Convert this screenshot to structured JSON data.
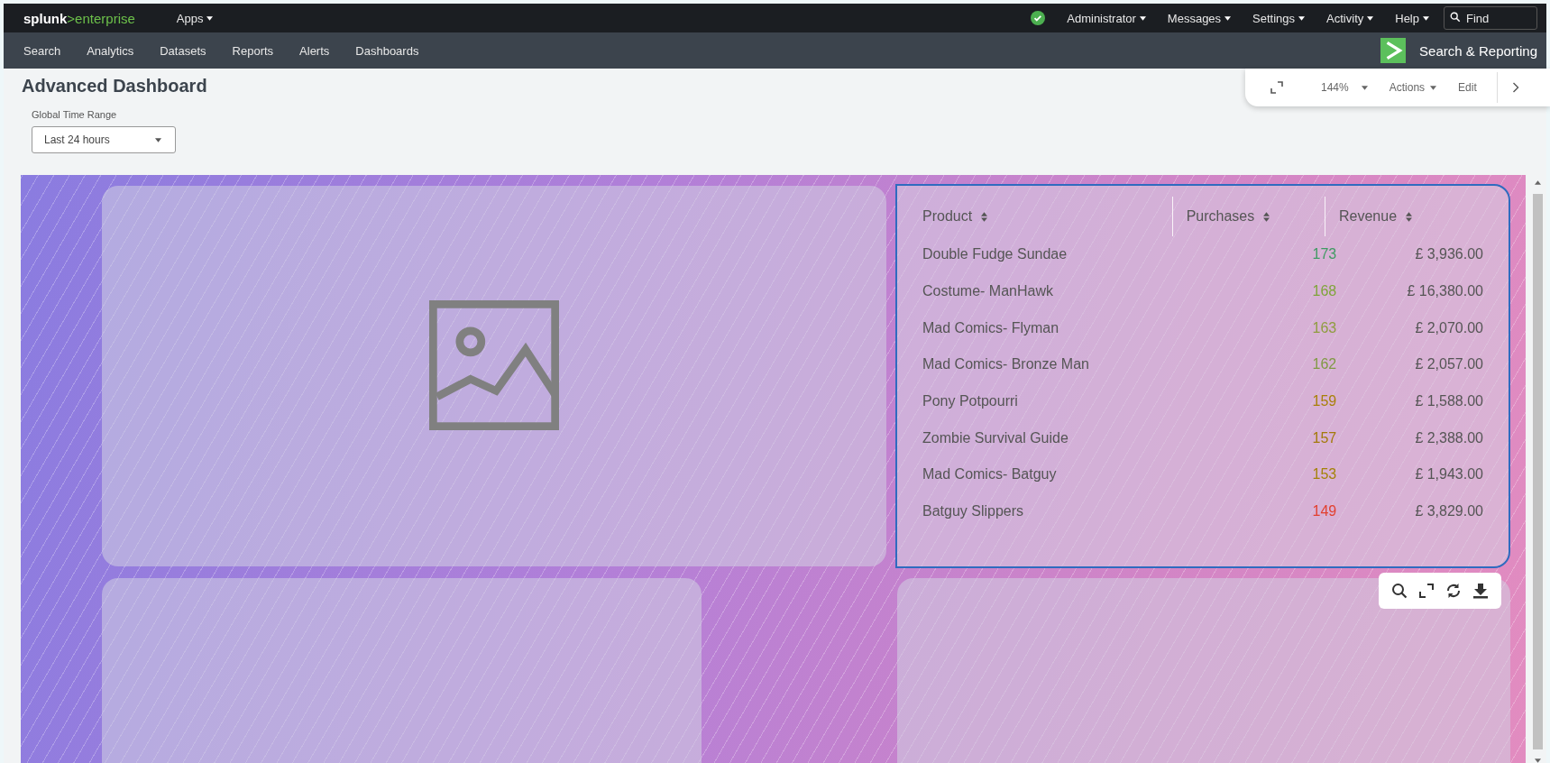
{
  "topbar": {
    "logo": {
      "brand": "splunk",
      "product": ">enterprise"
    },
    "apps_menu": "Apps",
    "menus": [
      "Administrator",
      "Messages",
      "Settings",
      "Activity",
      "Help"
    ],
    "search": {
      "placeholder": "Find"
    }
  },
  "nav": {
    "items": [
      "Search",
      "Analytics",
      "Datasets",
      "Reports",
      "Alerts",
      "Dashboards"
    ],
    "app_name": "Search & Reporting"
  },
  "dashboard": {
    "title": "Advanced Dashboard",
    "toolbar": {
      "zoom": "144%",
      "actions": "Actions",
      "edit": "Edit"
    }
  },
  "time_input": {
    "label": "Global Time Range",
    "value": "Last 24 hours"
  },
  "table": {
    "columns": [
      "Product",
      "Purchases",
      "Revenue"
    ],
    "rows": [
      {
        "product": "Double Fudge Sundae",
        "purchases": "173",
        "color": "#3f9a62",
        "revenue": "£ 3,936.00"
      },
      {
        "product": "Costume- ManHawk",
        "purchases": "168",
        "color": "#7fa43a",
        "revenue": "£ 16,380.00"
      },
      {
        "product": "Mad Comics- Flyman",
        "purchases": "163",
        "color": "#8f9d3f",
        "revenue": "£ 2,070.00"
      },
      {
        "product": "Mad Comics- Bronze Man",
        "purchases": "162",
        "color": "#809a44",
        "revenue": "£ 2,057.00"
      },
      {
        "product": "Pony Potpourri",
        "purchases": "159",
        "color": "#a87f08",
        "revenue": "£ 1,588.00"
      },
      {
        "product": "Zombie Survival Guide",
        "purchases": "157",
        "color": "#a37a0a",
        "revenue": "£ 2,388.00"
      },
      {
        "product": "Mad Comics- Batguy",
        "purchases": "153",
        "color": "#a48208",
        "revenue": "£ 1,943.00"
      },
      {
        "product": "Batguy Slippers",
        "purchases": "149",
        "color": "#e2402f",
        "revenue": "£ 3,829.00"
      }
    ]
  }
}
